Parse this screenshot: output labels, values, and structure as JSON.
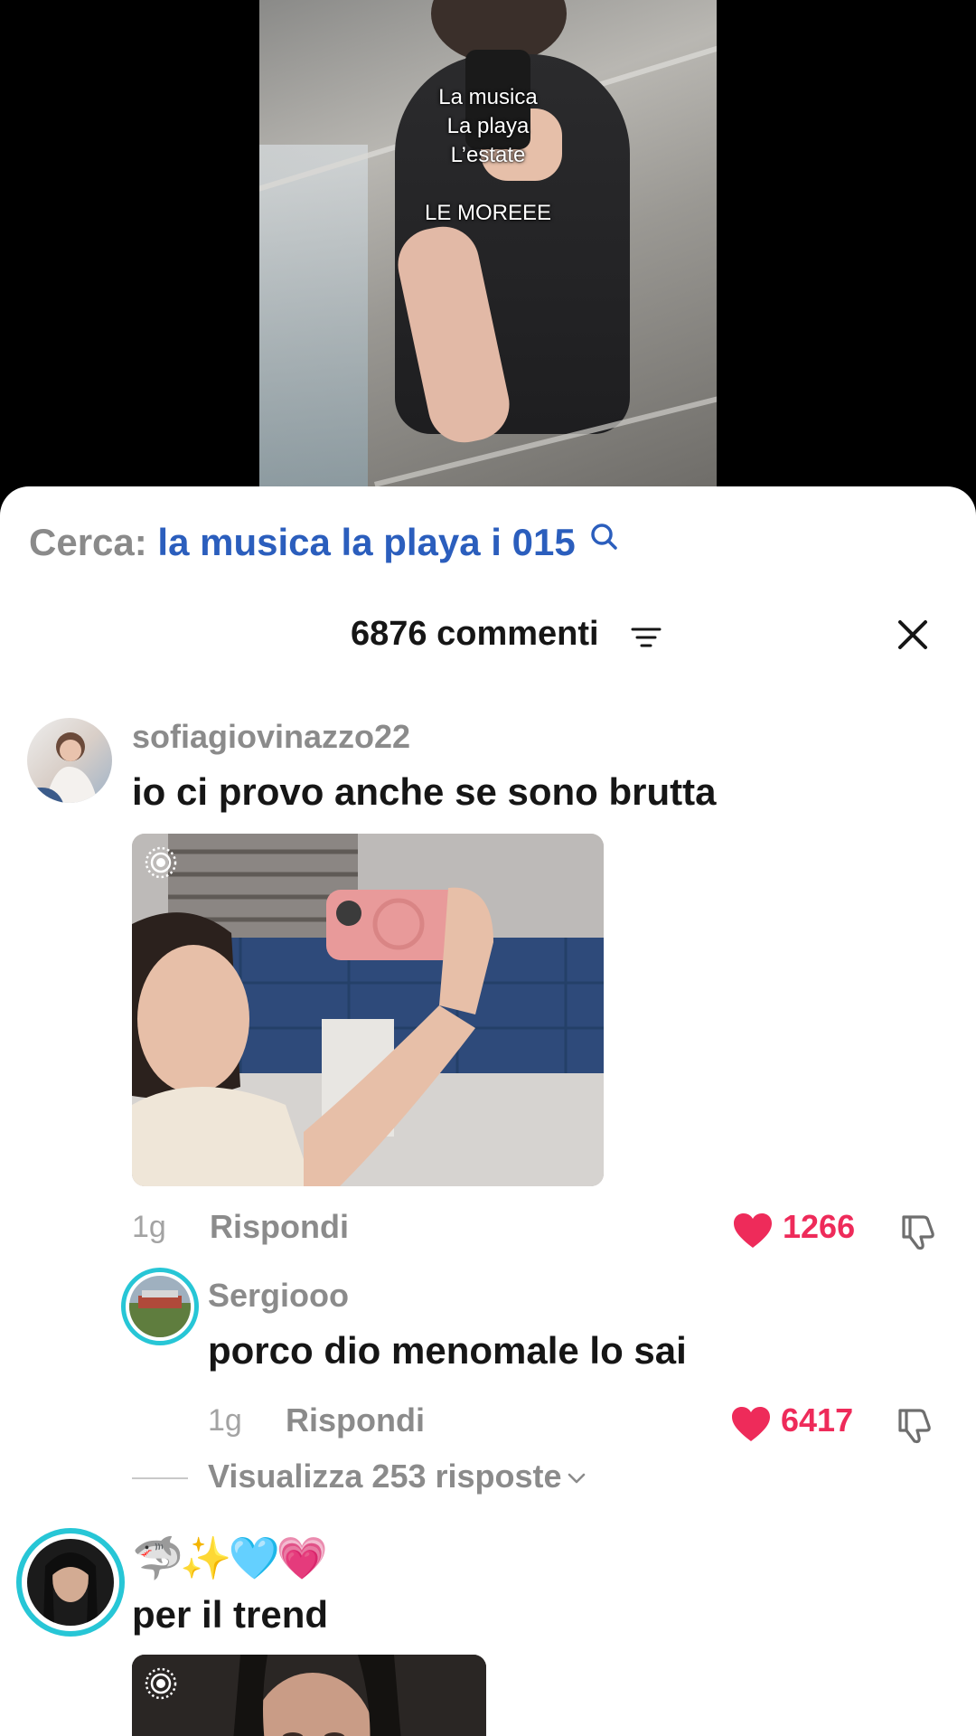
{
  "video": {
    "overlay_lines": [
      "La musica",
      "La playa",
      "L’estate",
      "LE MOREEE"
    ]
  },
  "search": {
    "prefix": "Cerca:",
    "query": "la musica la playa i 015",
    "icon": "search-icon"
  },
  "header": {
    "comment_count": "6876 commenti",
    "filter_icon": "filter-icon",
    "close_icon": "close-icon"
  },
  "comments": [
    {
      "username": "sofiagiovinazzo22",
      "text": "io ci provo anche se sono brutta",
      "has_image": true,
      "time": "1g",
      "reply_label": "Rispondi",
      "likes": "1266",
      "liked": true
    },
    {
      "username": "🦈✨🩵💗",
      "text": "per il trend",
      "has_image": true
    }
  ],
  "reply": {
    "username": "Sergiooo",
    "text": "porco dio menomale lo sai",
    "time": "1g",
    "reply_label": "Rispondi",
    "likes": "6417",
    "liked": true
  },
  "view_replies": {
    "label": "Visualizza 253 risposte"
  },
  "colors": {
    "like": "#ee2b5a",
    "search_query": "#2b5ebd",
    "story_ring": "#27c6d6"
  }
}
